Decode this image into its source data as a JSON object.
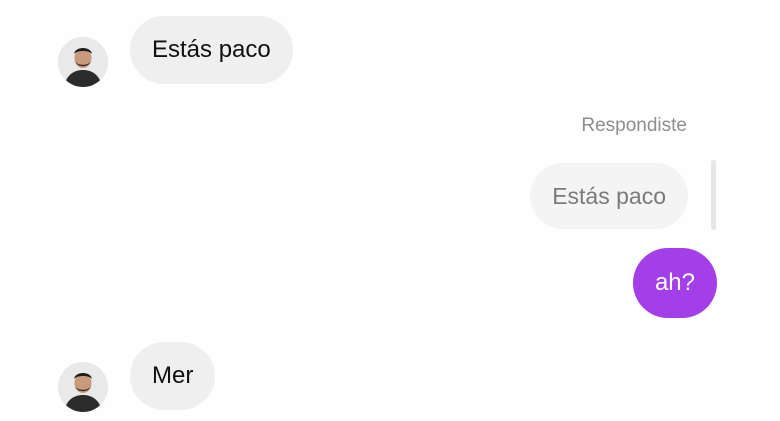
{
  "conversation": {
    "messages": [
      {
        "sender": "contact",
        "text": "Estás paco"
      },
      {
        "sender": "me",
        "reply_label": "Respondiste",
        "quoted_text": "Estás paco",
        "text": "ah?"
      },
      {
        "sender": "contact",
        "text": "Mer"
      }
    ]
  },
  "colors": {
    "outgoing_bubble": "#a23fe8",
    "incoming_bubble": "#efefef",
    "quote_bubble": "#f4f4f4",
    "reply_label": "#8e8e8e"
  },
  "icons": {
    "contact_avatar": "profile-photo"
  }
}
